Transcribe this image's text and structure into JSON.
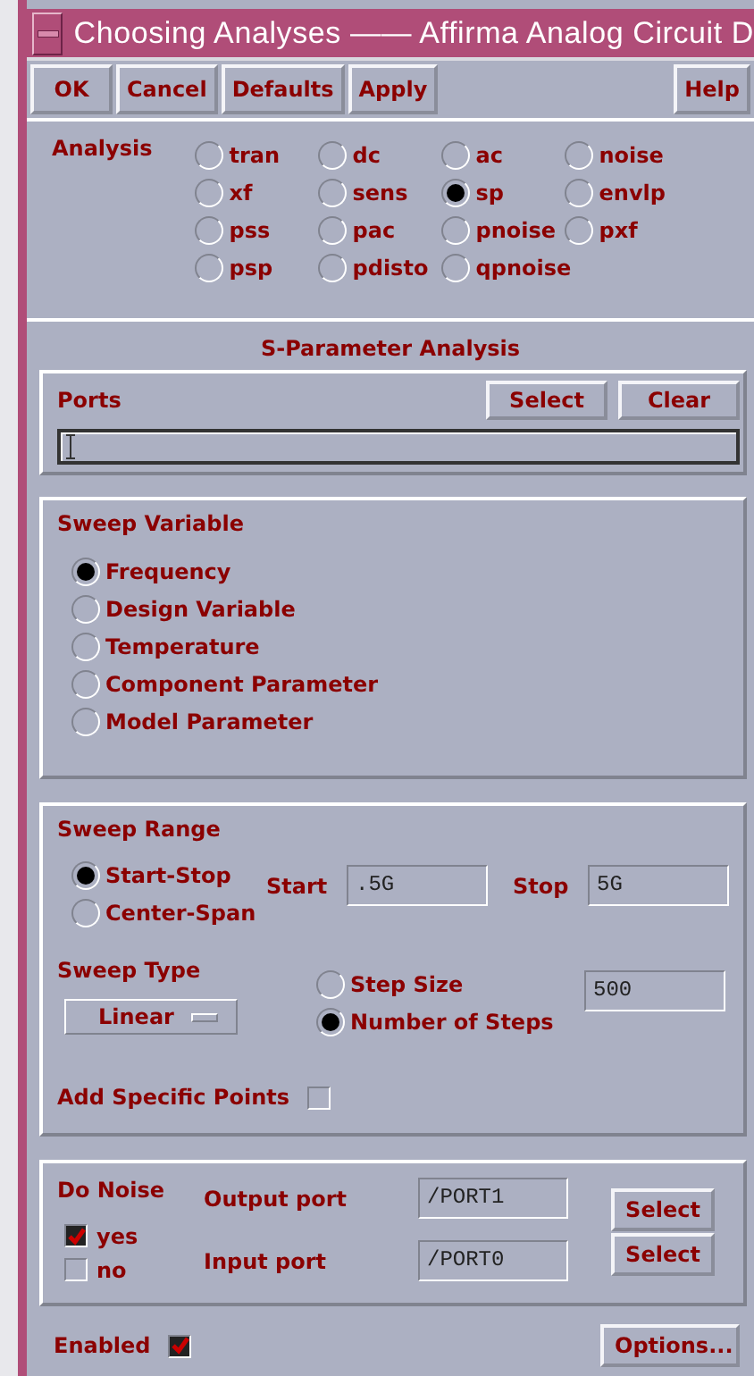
{
  "window": {
    "title": "Choosing Analyses —— Affirma Analog Circuit D"
  },
  "toolbar": {
    "buttons": [
      "OK",
      "Cancel",
      "Defaults",
      "Apply"
    ],
    "help": "Help"
  },
  "analysis": {
    "label": "Analysis",
    "options": [
      {
        "label": "tran",
        "selected": false
      },
      {
        "label": "dc",
        "selected": false
      },
      {
        "label": "ac",
        "selected": false
      },
      {
        "label": "noise",
        "selected": false
      },
      {
        "label": "xf",
        "selected": false
      },
      {
        "label": "sens",
        "selected": false
      },
      {
        "label": "sp",
        "selected": true
      },
      {
        "label": "envlp",
        "selected": false
      },
      {
        "label": "pss",
        "selected": false
      },
      {
        "label": "pac",
        "selected": false
      },
      {
        "label": "pnoise",
        "selected": false
      },
      {
        "label": "pxf",
        "selected": false
      },
      {
        "label": "psp",
        "selected": false
      },
      {
        "label": "pdisto",
        "selected": false
      },
      {
        "label": "qpnoise",
        "selected": false
      }
    ]
  },
  "section_title": "S-Parameter Analysis",
  "ports": {
    "label": "Ports",
    "select": "Select",
    "clear": "Clear"
  },
  "sweep_variable": {
    "label": "Sweep Variable",
    "options": [
      {
        "label": "Frequency",
        "selected": true
      },
      {
        "label": "Design Variable",
        "selected": false
      },
      {
        "label": "Temperature",
        "selected": false
      },
      {
        "label": "Component Parameter",
        "selected": false
      },
      {
        "label": "Model Parameter",
        "selected": false
      }
    ]
  },
  "sweep_range": {
    "label": "Sweep Range",
    "modes": [
      {
        "label": "Start-Stop",
        "selected": true
      },
      {
        "label": "Center-Span",
        "selected": false
      }
    ],
    "start": {
      "label": "Start",
      "value": ".5G"
    },
    "stop": {
      "label": "Stop",
      "value": "5G"
    },
    "sweep_type": {
      "label": "Sweep Type",
      "value": "Linear"
    },
    "step_modes": [
      {
        "label": "Step Size",
        "selected": false
      },
      {
        "label": "Number of Steps",
        "selected": true
      }
    ],
    "steps": {
      "value": "500"
    },
    "add_specific_points": {
      "label": "Add Specific Points",
      "checked": false
    }
  },
  "do_noise": {
    "label": "Do Noise",
    "options": [
      {
        "label": "yes",
        "checked": true
      },
      {
        "label": "no",
        "checked": false
      }
    ],
    "output_port": {
      "label": "Output port",
      "value": "/PORT1",
      "button": "Select"
    },
    "input_port": {
      "label": "Input port",
      "value": "/PORT0",
      "button": "Select"
    }
  },
  "enabled": {
    "label": "Enabled",
    "checked": true
  },
  "options_button": "Options..."
}
